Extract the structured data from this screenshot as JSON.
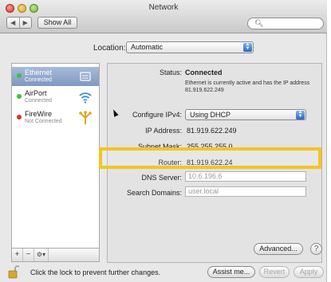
{
  "window": {
    "title": "Network"
  },
  "toolbar": {
    "back_label": "◀",
    "forward_label": "▶",
    "show_all_label": "Show All",
    "search_placeholder": ""
  },
  "location": {
    "label": "Location:",
    "value": "Automatic"
  },
  "services": [
    {
      "name": "Ethernet",
      "status": "Connected",
      "status_color": "#3fbf3f",
      "icon": "ethernet-icon",
      "selected": true
    },
    {
      "name": "AirPort",
      "status": "Connected",
      "status_color": "#3fbf3f",
      "icon": "airport-wifi-icon",
      "selected": false
    },
    {
      "name": "FireWire",
      "status": "Not Connected",
      "status_color": "#d8322a",
      "icon": "firewire-icon",
      "selected": false
    }
  ],
  "sidebar_tools": {
    "add": "+",
    "remove": "−",
    "gear": "⚙▾"
  },
  "details": {
    "status_label": "Status:",
    "status_value": "Connected",
    "status_description": "Ethernet is currently active and has the IP address 81.919.622.249",
    "configure_label": "Configure IPv4:",
    "configure_value": "Using DHCP",
    "ip_label": "IP Address:",
    "ip_value": "81.919.622.249",
    "subnet_label": "Subnet Mask:",
    "subnet_value": "255.255.255.0",
    "router_label": "Router:",
    "router_value": "81.919.622.24",
    "dns_label": "DNS Server:",
    "dns_value": "10.6.196.6",
    "search_domains_label": "Search Domains:",
    "search_domains_placeholder": "user.local"
  },
  "buttons": {
    "advanced": "Advanced...",
    "help": "?",
    "assist": "Assist me...",
    "revert": "Revert",
    "apply": "Apply"
  },
  "footer": {
    "lock_message": "Click the lock to prevent further changes."
  },
  "colors": {
    "highlight": "#f3c61f",
    "selection": "#8099c0",
    "accent_blue": "#2b67c6"
  }
}
